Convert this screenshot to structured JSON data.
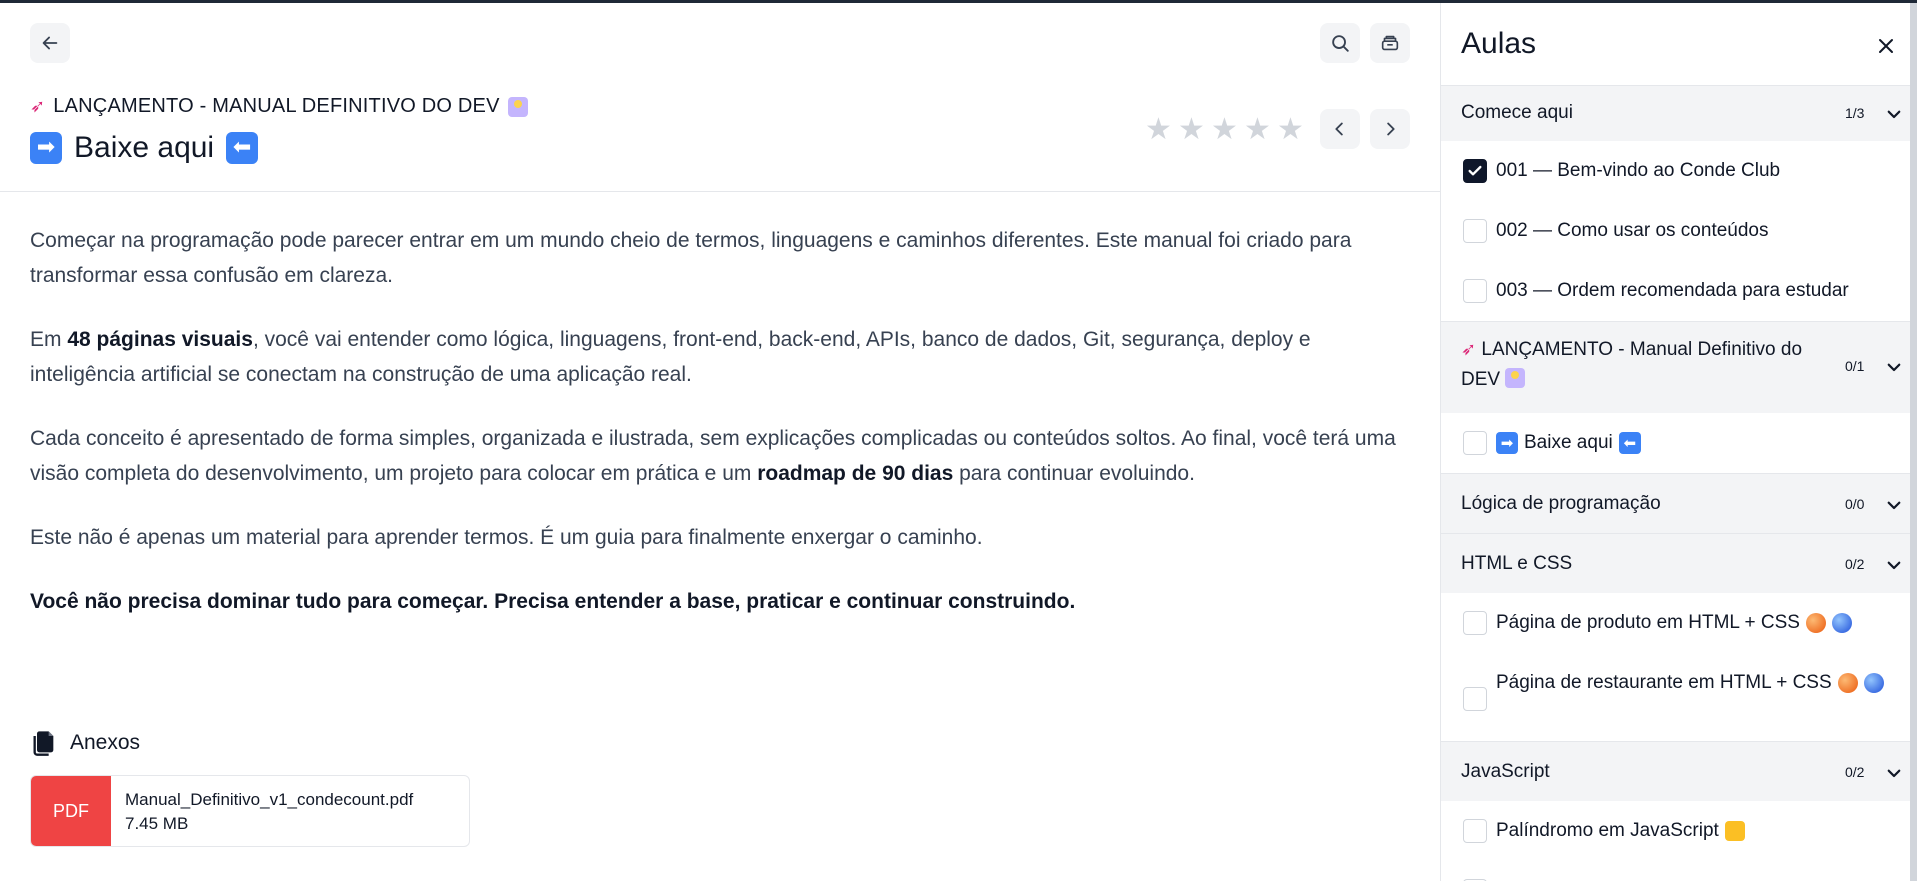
{
  "header": {
    "course_title": "LANÇAMENTO - MANUAL DEFINITIVO DO DEV",
    "lesson_title": "Baixe aqui",
    "lesson_arrow_left": "➡",
    "lesson_arrow_right": "⬅"
  },
  "icons": {
    "back": "arrow-left-icon",
    "search": "search-icon",
    "archive": "archive-icon",
    "prev": "chevron-left-icon",
    "next": "chevron-right-icon",
    "close": "close-icon"
  },
  "rating": {
    "value": 0,
    "max": 5
  },
  "content": {
    "p1": "Começar na programação pode parecer entrar em um mundo cheio de termos, linguagens e caminhos diferentes. Este manual foi criado para transformar essa confusão em clareza.",
    "p2_pre": "Em ",
    "p2_bold": "48 páginas visuais",
    "p2_post": ", você vai entender como lógica, linguagens, front-end, back-end, APIs, banco de dados, Git, segurança, deploy e inteligência artificial se conectam na construção de uma aplicação real.",
    "p3_pre": "Cada conceito é apresentado de forma simples, organizada e ilustrada, sem explicações complicadas ou conteúdos soltos. Ao final, você terá uma visão completa do desenvolvimento, um projeto para colocar em prática e um ",
    "p3_bold": "roadmap de 90 dias",
    "p3_post": " para continuar evoluindo.",
    "p4": "Este não é apenas um material para aprender termos. É um guia para finalmente enxergar o caminho.",
    "p5": "Você não precisa dominar tudo para começar. Precisa entender a base, praticar e continuar construindo."
  },
  "attachments": {
    "title": "Anexos",
    "file": {
      "type": "PDF",
      "name": "Manual_Definitivo_v1_condecount.pdf",
      "size": "7.45 MB"
    }
  },
  "sidebar": {
    "title": "Aulas",
    "sections": [
      {
        "name": "Comece aqui",
        "count": "1/3",
        "items": [
          {
            "label": "001 — Bem-vindo ao Conde Club",
            "checked": true
          },
          {
            "label": "002 — Como usar os conteúdos",
            "checked": false
          },
          {
            "label": "003 — Ordem recomendada para estudar",
            "checked": false
          }
        ]
      },
      {
        "name_line1": "LANÇAMENTO - Manual Definitivo do",
        "name_line2": "DEV",
        "count": "0/1",
        "items": [
          {
            "label": "Baixe aqui",
            "checked": false
          }
        ]
      },
      {
        "name": "Lógica de programação",
        "count": "0/0",
        "items": []
      },
      {
        "name": "HTML e CSS",
        "count": "0/2",
        "items": [
          {
            "label": "Página de produto em HTML + CSS",
            "checked": false
          },
          {
            "label": "Página de restaurante em HTML + CSS",
            "checked": false
          }
        ]
      },
      {
        "name": "JavaScript",
        "count": "0/2",
        "items": [
          {
            "label": "Palíndromo em JavaScript",
            "checked": false
          }
        ]
      }
    ]
  },
  "colors": {
    "pdf": "#ef4444",
    "checkbox_checked": "#0f172a",
    "section_bg": "#f3f4f6",
    "star": "#d1d5db"
  }
}
